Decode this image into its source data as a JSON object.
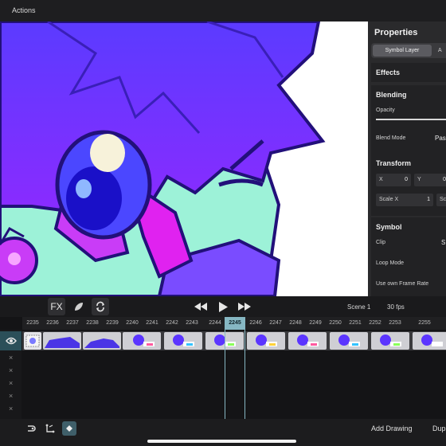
{
  "topbar": {
    "actions_label": "Actions"
  },
  "properties": {
    "title": "Properties",
    "tabs": [
      {
        "label": "Symbol Layer"
      },
      {
        "label": "A"
      }
    ],
    "effects": {
      "header": "Effects"
    },
    "blending": {
      "header": "Blending",
      "opacity_label": "Opacity",
      "blend_mode_label": "Blend Mode",
      "blend_mode_value": "Pas"
    },
    "transform": {
      "header": "Transform",
      "x_label": "X",
      "x_value": "0",
      "y_label": "Y",
      "y_value": "0",
      "scale_x_label": "Scale X",
      "scale_x_value": "1",
      "scale_y_label": "Sca"
    },
    "symbol": {
      "header": "Symbol",
      "clip_label": "Clip",
      "clip_value": "S",
      "loop_mode_label": "Loop Mode",
      "own_frame_rate_label": "Use own Frame Rate"
    }
  },
  "playback": {
    "fx_label": "FX",
    "scene_label": "Scene 1",
    "fps_label": "30 fps"
  },
  "timeline": {
    "frames": [
      "2235",
      "2236",
      "2237",
      "2238",
      "2239",
      "2240",
      "2241",
      "2242",
      "2243",
      "2244",
      "2245",
      "2246",
      "2247",
      "2248",
      "2249",
      "2250",
      "2251",
      "2252",
      "2253",
      "2255"
    ],
    "current_frame": "2245",
    "empty_layer_marks": [
      "×",
      "×",
      "×",
      "×",
      "×"
    ]
  },
  "bottom": {
    "add_drawing_label": "Add Drawing",
    "duplicate_label": "Dup"
  },
  "icons": {
    "eye": "eye-icon",
    "brush": "brush-icon",
    "loop": "loop-icon",
    "rewind": "rewind-icon",
    "play": "play-icon",
    "fast_forward": "fast-forward-icon",
    "bone": "bone-tool-icon",
    "path": "path-tool-icon",
    "diamond": "keyframe-icon"
  },
  "colors": {
    "accent": "#86b7c3",
    "panel": "#2a2a2c",
    "art_purple": "#6a2bff"
  }
}
